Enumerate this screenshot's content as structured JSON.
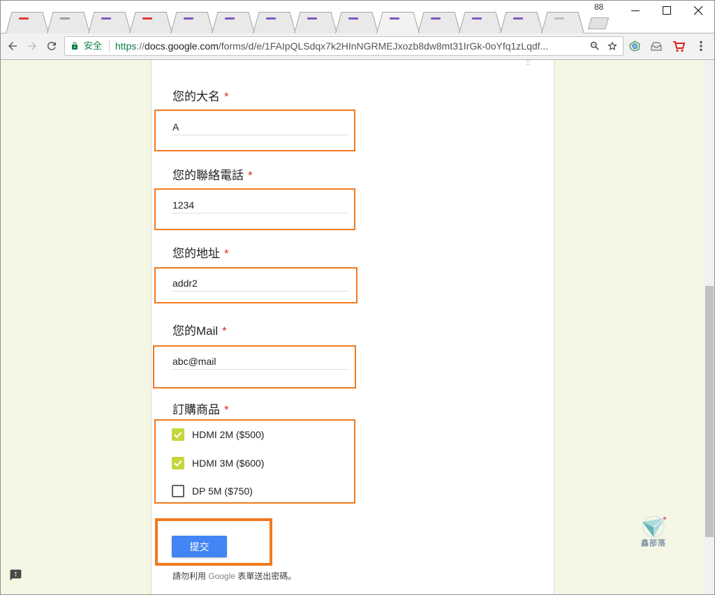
{
  "window": {
    "badge": "88",
    "controls": [
      "minimize-icon",
      "maximize-icon",
      "close-icon"
    ]
  },
  "tabs": [
    {
      "favicon": "site-favicon-icon",
      "favicon_color": "#e53935",
      "active": false
    },
    {
      "favicon": "site-favicon-icon",
      "favicon_color": "#9e9e9e",
      "active": false
    },
    {
      "favicon": "forms-favicon-icon",
      "favicon_color": "#7e57c2",
      "active": false
    },
    {
      "favicon": "site-favicon-icon",
      "favicon_color": "#e53935",
      "active": false
    },
    {
      "favicon": "forms-favicon-icon",
      "favicon_color": "#7e57c2",
      "active": false
    },
    {
      "favicon": "forms-favicon-icon",
      "favicon_color": "#7e57c2",
      "active": false
    },
    {
      "favicon": "forms-favicon-icon",
      "favicon_color": "#7e57c2",
      "active": false
    },
    {
      "favicon": "forms-favicon-icon",
      "favicon_color": "#7e57c2",
      "active": false
    },
    {
      "favicon": "forms-favicon-icon",
      "favicon_color": "#7e57c2",
      "active": false
    },
    {
      "favicon": "forms-favicon-icon",
      "favicon_color": "#7e57c2",
      "active": true
    },
    {
      "favicon": "forms-favicon-icon",
      "favicon_color": "#7e57c2",
      "active": false
    },
    {
      "favicon": "forms-favicon-icon",
      "favicon_color": "#7e57c2",
      "active": false
    },
    {
      "favicon": "forms-favicon-icon",
      "favicon_color": "#7e57c2",
      "active": false
    },
    {
      "favicon": "site-favicon-icon",
      "favicon_color": "#bdbdbd",
      "active": false
    }
  ],
  "toolbar": {
    "icons": [
      "back-arrow-icon",
      "forward-arrow-icon",
      "reload-icon",
      "lock-icon",
      "zoom-out-icon",
      "star-icon",
      "extension-gem-icon",
      "extension-inbox-icon",
      "extension-cart-icon",
      "menu-dots-icon"
    ],
    "secure_label": "安全",
    "url": {
      "scheme": "https",
      "separator": "://",
      "host": "docs.google.com",
      "path": "/forms/d/e/1FAIpQLSdqx7k2HInNGRMEJxozb8dw8mt31IrGk-0oYfq1zLqdf..."
    }
  },
  "form": {
    "fields": [
      {
        "label": "您的大名",
        "required": "*",
        "value": "A"
      },
      {
        "label": "您的聯絡電話",
        "required": "*",
        "value": "1234"
      },
      {
        "label": "您的地址",
        "required": "*",
        "value": "addr2"
      },
      {
        "label": "您的Mail",
        "required": "*",
        "value": "abc@mail"
      }
    ],
    "products": {
      "label": "訂購商品",
      "required": "*",
      "options": [
        {
          "label": "HDMI 2M ($500)",
          "checked": true
        },
        {
          "label": "HDMI 3M ($600)",
          "checked": true
        },
        {
          "label": "DP 5M ($750)",
          "checked": false
        }
      ]
    },
    "submit_label": "提交",
    "footer": {
      "prefix": "請勿利用 ",
      "brand": "Google",
      "suffix": " 表單送出密碼。"
    }
  },
  "watermark": {
    "text": "鑫部落"
  },
  "feedback": {
    "icon": "feedback-icon"
  },
  "colors": {
    "page-bg": "#f4f7e4",
    "orange": "#f17a1e",
    "blue": "#4285f4",
    "check": "#c5d63d",
    "req": "#d93025",
    "secure": "#0b8043"
  }
}
